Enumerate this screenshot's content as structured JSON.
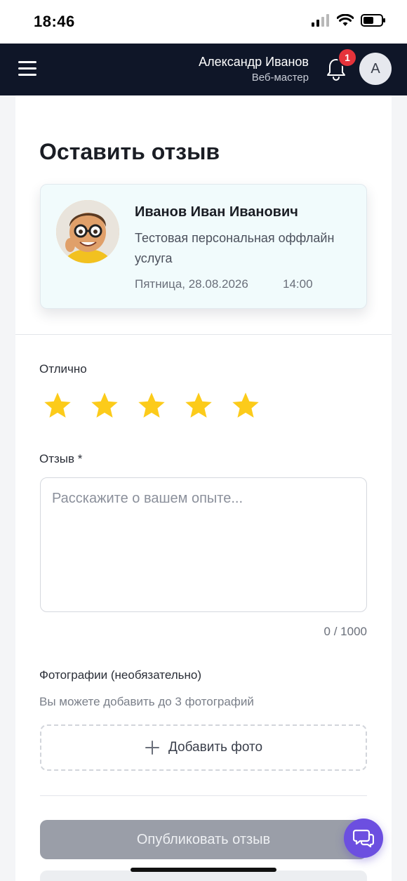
{
  "status_bar": {
    "time": "18:46"
  },
  "header": {
    "user_name": "Александр Иванов",
    "user_role": "Веб-мастер",
    "notifications_count": "1",
    "avatar_initial": "A"
  },
  "page": {
    "title": "Оставить отзыв"
  },
  "service_card": {
    "specialist_name": "Иванов Иван Иванович",
    "service_title": "Тестовая персональная оффлайн услуга",
    "date": "Пятница, 28.08.2026",
    "time": "14:00"
  },
  "rating": {
    "label": "Отлично",
    "value": 5,
    "max": 5,
    "star_color": "#FCCB1A"
  },
  "review": {
    "label": "Отзыв *",
    "placeholder": "Расскажите о вашем опыте...",
    "value": "",
    "counter": "0 / 1000"
  },
  "photos": {
    "label": "Фотографии (необязательно)",
    "hint": "Вы можете добавить до 3 фотографий",
    "add_label": "Добавить фото"
  },
  "actions": {
    "publish_label": "Опубликовать отзыв"
  },
  "colors": {
    "header_bg": "#0F1628",
    "badge": "#E5333B",
    "chat_fab": "#6C4FE0",
    "publish_disabled": "#9A9EA8"
  }
}
